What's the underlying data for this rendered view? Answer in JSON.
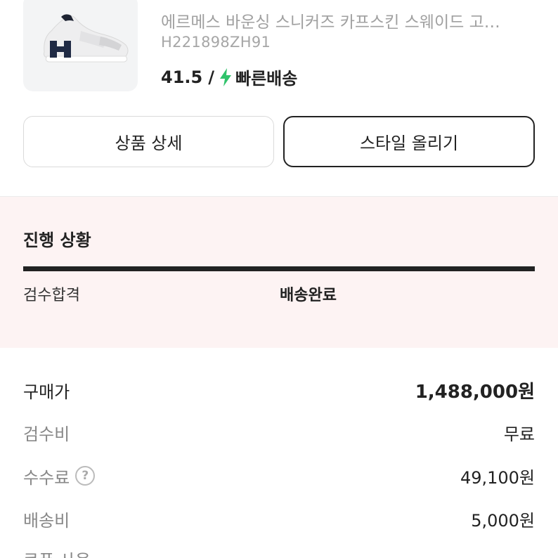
{
  "product": {
    "subtitle": "에르메스 바운싱 스니커즈 카프스킨 스웨이드 고…",
    "code": "H221898ZH91",
    "size": "41.5",
    "separator": "/",
    "shipping_label": "빠른배송",
    "bolt_color": "#30c36b",
    "image_icon": "sneaker-image"
  },
  "buttons": {
    "detail": "상품 상세",
    "style": "스타일 올리기"
  },
  "progress": {
    "title": "진행 상황",
    "steps": [
      "검수합격",
      "배송완료"
    ],
    "fill_fraction": 1.0,
    "background": "#fdf3f3"
  },
  "prices": [
    {
      "label": "구매가",
      "value": "1,488,000원"
    },
    {
      "label": "검수비",
      "value": "무료"
    },
    {
      "label": "수수료",
      "value": "49,100원",
      "help": "?"
    },
    {
      "label": "배송비",
      "value": "5,000원"
    },
    {
      "label": "쿠폰 사용",
      "value": ""
    }
  ]
}
